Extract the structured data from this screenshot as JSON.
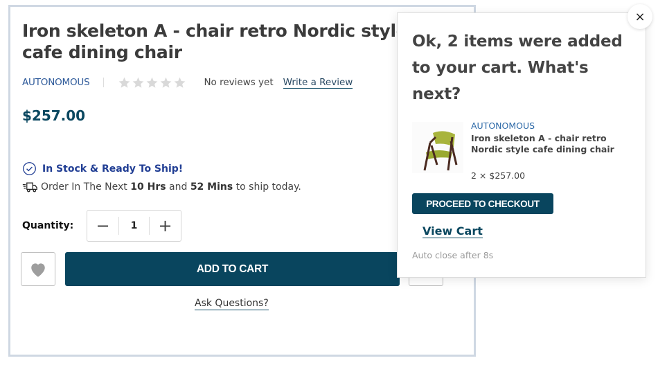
{
  "product": {
    "title_line1": "Iron skeleton A - chair retro Nordic style",
    "title_line2": "cafe dining chair",
    "brand": "AUTONOMOUS",
    "rating": {
      "value": 0,
      "max": 5
    },
    "reviews_text": "No reviews yet",
    "write_review": "Write a Review",
    "price": "$257.00",
    "stock_status": "In Stock & Ready To Ship!",
    "shipping": {
      "prefix": "Order In The Next ",
      "hours": "10 Hrs",
      "middle": " and ",
      "mins": "52 Mins",
      "suffix": " to ship today."
    },
    "quantity_label": "Quantity:",
    "quantity": "1",
    "decrement": "−",
    "increment": "+",
    "add_to_cart": "ADD TO CART",
    "ask_questions": "Ask Questions?"
  },
  "popup": {
    "title": "Ok, 2 items were added to your cart. What's next?",
    "item": {
      "brand": "AUTONOMOUS",
      "name": "Iron skeleton A - chair retro Nordic style cafe dining chair",
      "qty_price": "2 × $257.00"
    },
    "checkout": "PROCEED TO CHECKOUT",
    "view_cart": "View Cart",
    "auto_close": "Auto close after 8s",
    "close": "×"
  },
  "colors": {
    "primary": "#09455e",
    "brand_link": "#2e5a9a",
    "stock": "#213e94",
    "star_empty": "#d9d9d9"
  }
}
